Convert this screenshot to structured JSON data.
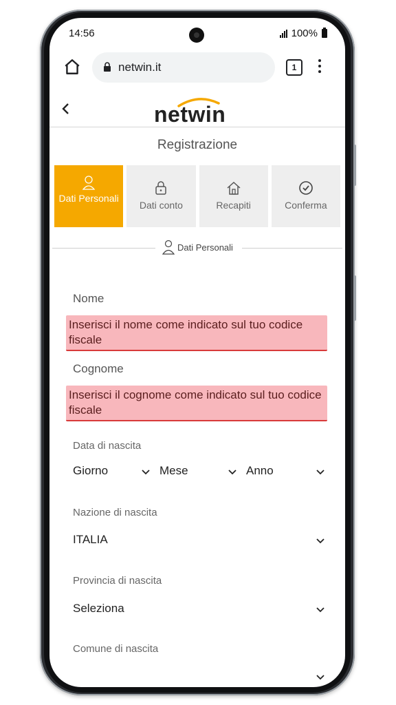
{
  "status_bar": {
    "time": "14:56",
    "battery": "100%"
  },
  "browser": {
    "url": "netwin.it",
    "tab_count": "1"
  },
  "app": {
    "logo_text": "netwin",
    "page_title": "Registrazione"
  },
  "steps": [
    {
      "label": "Dati Personali",
      "icon": "user-icon",
      "active": true
    },
    {
      "label": "Dati conto",
      "icon": "lock-icon",
      "active": false
    },
    {
      "label": "Recapiti",
      "icon": "house-icon",
      "active": false
    },
    {
      "label": "Conferma",
      "icon": "check-circle-icon",
      "active": false
    }
  ],
  "section": {
    "label": "Dati Personali"
  },
  "form": {
    "nome_label": "Nome",
    "nome_error": "Inserisci il nome come indicato sul tuo codice fiscale",
    "cognome_label": "Cognome",
    "cognome_error": "Inserisci il cognome come indicato sul tuo codice fiscale",
    "data_label": "Data di nascita",
    "giorno": "Giorno",
    "mese": "Mese",
    "anno": "Anno",
    "nazione_label": "Nazione di nascita",
    "nazione_value": "ITALIA",
    "provincia_label": "Provincia di nascita",
    "provincia_value": "Seleziona",
    "comune_label": "Comune di nascita"
  },
  "colors": {
    "accent": "#f5a800",
    "error_bg": "#f8b7bc",
    "error_border": "#d83a3a"
  }
}
